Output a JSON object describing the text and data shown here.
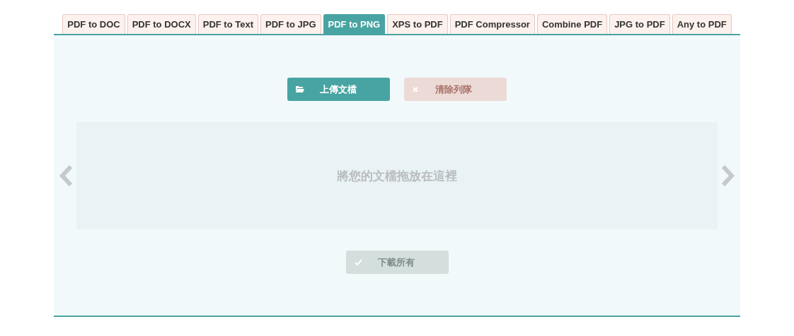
{
  "tabs": [
    {
      "label": "PDF to DOC",
      "selected": false
    },
    {
      "label": "PDF to DOCX",
      "selected": false
    },
    {
      "label": "PDF to Text",
      "selected": false
    },
    {
      "label": "PDF to JPG",
      "selected": false
    },
    {
      "label": "PDF to PNG",
      "selected": true
    },
    {
      "label": "XPS to PDF",
      "selected": false
    },
    {
      "label": "PDF Compressor",
      "selected": false
    },
    {
      "label": "Combine PDF",
      "selected": false
    },
    {
      "label": "JPG to PDF",
      "selected": false
    },
    {
      "label": "Any to PDF",
      "selected": false
    }
  ],
  "actions": [
    {
      "kind": "upload",
      "label": "上傳文檔",
      "disabled": false
    },
    {
      "kind": "clear",
      "label": "清除列隊",
      "disabled": true
    }
  ],
  "drop_zone": {
    "text": "將您的文檔拖放在這裡"
  },
  "download": {
    "kind": "download",
    "label": "下載所有",
    "disabled": true
  }
}
